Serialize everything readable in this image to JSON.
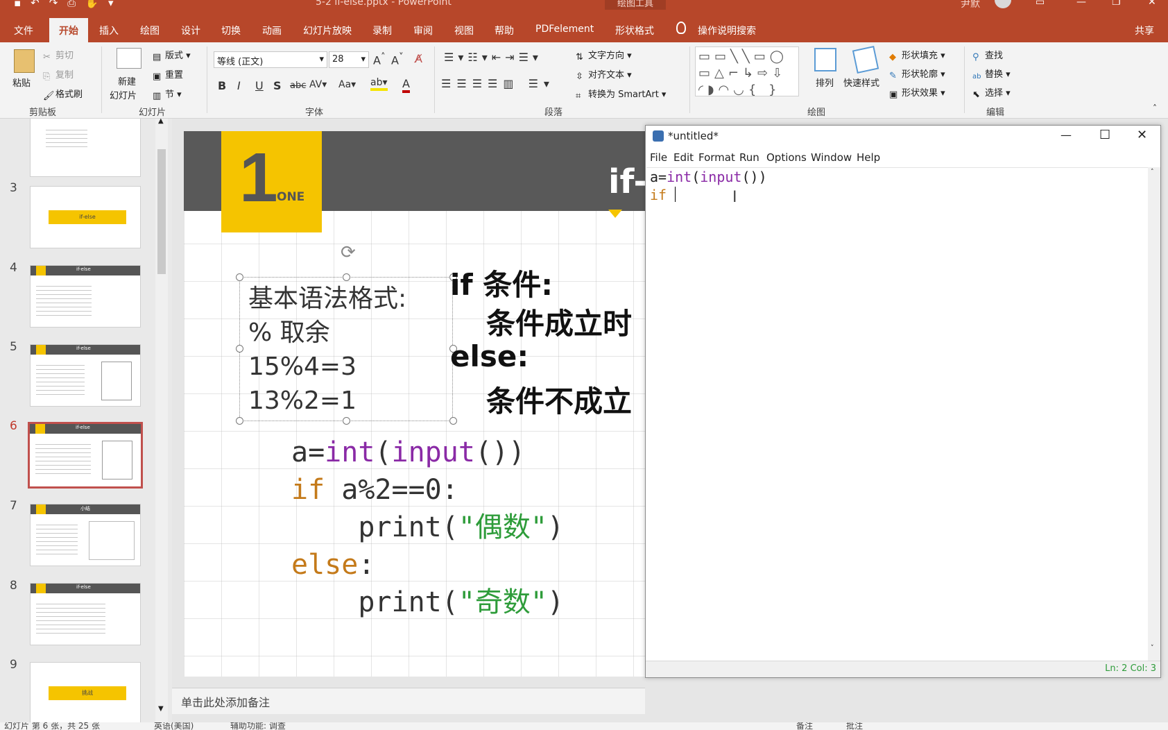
{
  "titlebar": {
    "context_label": "绘图工具",
    "doc_title": "5-2 if-else.pptx - PowerPoint",
    "user": "尹默"
  },
  "tabs": [
    {
      "label": "文件"
    },
    {
      "label": "开始"
    },
    {
      "label": "插入"
    },
    {
      "label": "绘图"
    },
    {
      "label": "设计"
    },
    {
      "label": "切换"
    },
    {
      "label": "动画"
    },
    {
      "label": "幻灯片放映"
    },
    {
      "label": "录制"
    },
    {
      "label": "审阅"
    },
    {
      "label": "视图"
    },
    {
      "label": "帮助"
    },
    {
      "label": "PDFelement"
    },
    {
      "label": "形状格式"
    }
  ],
  "tell_me": "操作说明搜索",
  "share": "共享",
  "ribbon": {
    "clipboard": {
      "paste": "粘贴",
      "cut": "剪切",
      "copy": "复制",
      "format_painter": "格式刷",
      "group": "剪贴板"
    },
    "slides": {
      "new_slide_1": "新建",
      "new_slide_2": "幻灯片",
      "layout": "版式",
      "reset": "重置",
      "section": "节",
      "group": "幻灯片"
    },
    "font": {
      "name": "等线 (正文)",
      "size": "28",
      "group": "字体"
    },
    "paragraph": {
      "text_direction": "文字方向",
      "align_text": "对齐文本",
      "smartart": "转换为 SmartArt",
      "group": "段落"
    },
    "drawing": {
      "arrange": "排列",
      "quick_styles": "快速样式",
      "fill": "形状填充",
      "outline": "形状轮廓",
      "effects": "形状效果",
      "group": "绘图"
    },
    "editing": {
      "find": "查找",
      "replace": "替换",
      "select": "选择",
      "group": "编辑"
    }
  },
  "thumbnails": [
    {
      "num": "3",
      "label": "if-else"
    },
    {
      "num": "4",
      "label": "if-else"
    },
    {
      "num": "5",
      "label": "if-else"
    },
    {
      "num": "6",
      "label": "if-else"
    },
    {
      "num": "7",
      "label": "小结"
    },
    {
      "num": "8",
      "label": "if-else"
    },
    {
      "num": "9",
      "label": "挑战"
    }
  ],
  "slide": {
    "number": "1",
    "one": "ONE",
    "title": "if-",
    "textbox": [
      "基本语法格式:",
      "% 取余",
      "15%4=3",
      "13%2=1"
    ],
    "syntax": {
      "if_line": "if  条件:",
      "if_body": "条件成立时",
      "else_line": "else:",
      "else_body": "条件不成立"
    },
    "code": {
      "l1a": "a=",
      "l1b": "int",
      "l1c": "(",
      "l1d": "input",
      "l1e": "())",
      "l2a": "if",
      "l2b": " a%2==0:",
      "l3a": "    print(",
      "l3b": "\"偶数\"",
      "l3c": ")",
      "l4a": "else",
      ":": ":",
      "l5a": "    print(",
      "l5b": "\"奇数\"",
      "l5c": ")"
    }
  },
  "notes_placeholder": "单击此处添加备注",
  "status": {
    "slide_info": "幻灯片 第 6 张，共 25 张",
    "lang": "英语(美国)",
    "access": "辅助功能: 调查",
    "notes": "备注",
    "comments": "批注"
  },
  "idle": {
    "title": "*untitled*",
    "menu": [
      "File",
      "Edit",
      "Format",
      "Run",
      "Options",
      "Window",
      "Help"
    ],
    "code": {
      "l1a": "a=",
      "l1b": "int",
      "l1c": "(",
      "l1d": "input",
      "l1e": "())",
      "l2": "if "
    },
    "status": "Ln: 2  Col: 3"
  },
  "colors": {
    "accent": "#b7472a",
    "slide_yellow": "#f5c400",
    "slide_band": "#595959",
    "keyword": "#c47a1a",
    "builtin": "#8a2aa6",
    "string": "#2e9c3a"
  }
}
